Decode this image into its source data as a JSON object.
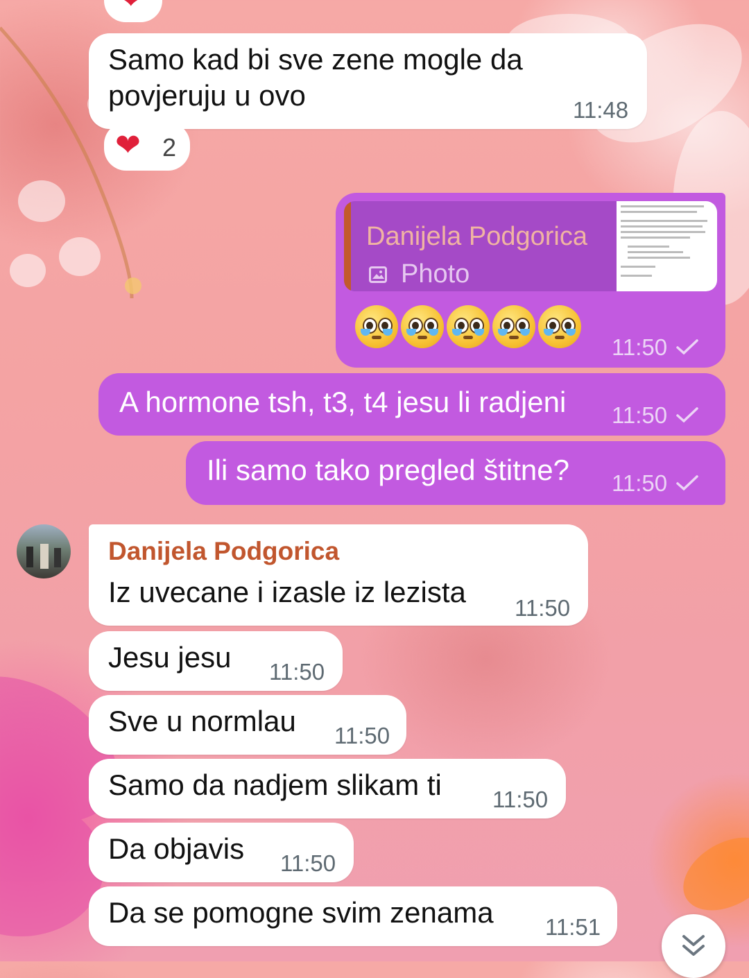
{
  "messages_top": {
    "reaction_top": "❤",
    "msg1": {
      "text_line1": "Samo kad bi sve zene mogle da",
      "text_line2": "povjeruju u ovo",
      "time": "11:48"
    },
    "reaction1": {
      "emoji": "❤",
      "count": "2"
    }
  },
  "outgoing": {
    "reply": {
      "author": "Danijela Podgorica",
      "media_label": "Photo"
    },
    "emojis_message": {
      "time": "11:50"
    },
    "msg2": {
      "text": "A hormone tsh, t3, t4 jesu li radjeni",
      "time": "11:50"
    },
    "msg3": {
      "text": "Ili samo tako pregled štitne?",
      "time": "11:50"
    }
  },
  "incoming": {
    "sender": "Danijela Podgorica",
    "items": [
      {
        "text": "Iz uvecane i izasle iz lezista",
        "time": "11:50"
      },
      {
        "text": "Jesu jesu",
        "time": "11:50"
      },
      {
        "text": "Sve u normlau",
        "time": "11:50"
      },
      {
        "text": "Samo da nadjem slikam ti",
        "time": "11:50"
      },
      {
        "text": "Da objavis",
        "time": "11:50"
      },
      {
        "text": "Da se pomogne svim zenama",
        "time": "11:51"
      }
    ]
  },
  "icons": {
    "scroll_down": "chevron-double-down-icon",
    "photo": "image-icon",
    "read": "check-icon"
  },
  "colors": {
    "outgoing_bubble": "#c25ae0",
    "incoming_bubble": "#ffffff",
    "sender_name": "#c1562e"
  }
}
